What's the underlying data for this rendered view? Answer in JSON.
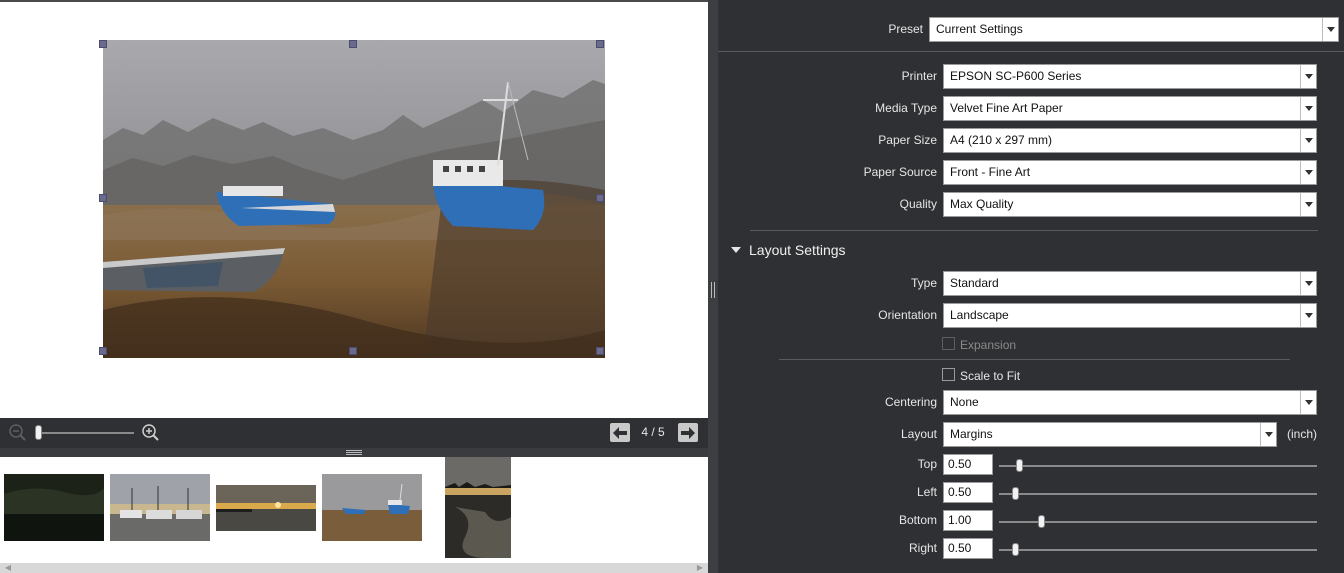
{
  "preview": {
    "page_indicator": "4 / 5",
    "zoom_level": 0.02
  },
  "filmstrip": {
    "thumbnails": [
      "thumb-1",
      "thumb-2",
      "thumb-3",
      "thumb-4",
      "thumb-5"
    ]
  },
  "settings": {
    "preset_label": "Preset",
    "preset_value": "Current Settings",
    "printer_label": "Printer",
    "printer_value": "EPSON SC-P600 Series",
    "media_type_label": "Media Type",
    "media_type_value": "Velvet Fine Art Paper",
    "paper_size_label": "Paper Size",
    "paper_size_value": "A4 (210 x 297 mm)",
    "paper_source_label": "Paper Source",
    "paper_source_value": "Front - Fine Art",
    "quality_label": "Quality",
    "quality_value": "Max Quality"
  },
  "layout_settings": {
    "header": "Layout Settings",
    "type_label": "Type",
    "type_value": "Standard",
    "orientation_label": "Orientation",
    "orientation_value": "Landscape",
    "expansion_label": "Expansion",
    "scale_to_fit_label": "Scale to Fit",
    "centering_label": "Centering",
    "centering_value": "None",
    "layout_label": "Layout",
    "layout_value": "Margins",
    "unit_label": "(inch)",
    "top_label": "Top",
    "top_value": "0.50",
    "left_label": "Left",
    "left_value": "0.50",
    "bottom_label": "Bottom",
    "bottom_value": "1.00",
    "right_label": "Right",
    "right_value": "0.50"
  },
  "colors": {
    "panel_bg": "#2f3033",
    "canvas_bg": "#ffffff",
    "boat_blue": "#2f6fb8"
  }
}
